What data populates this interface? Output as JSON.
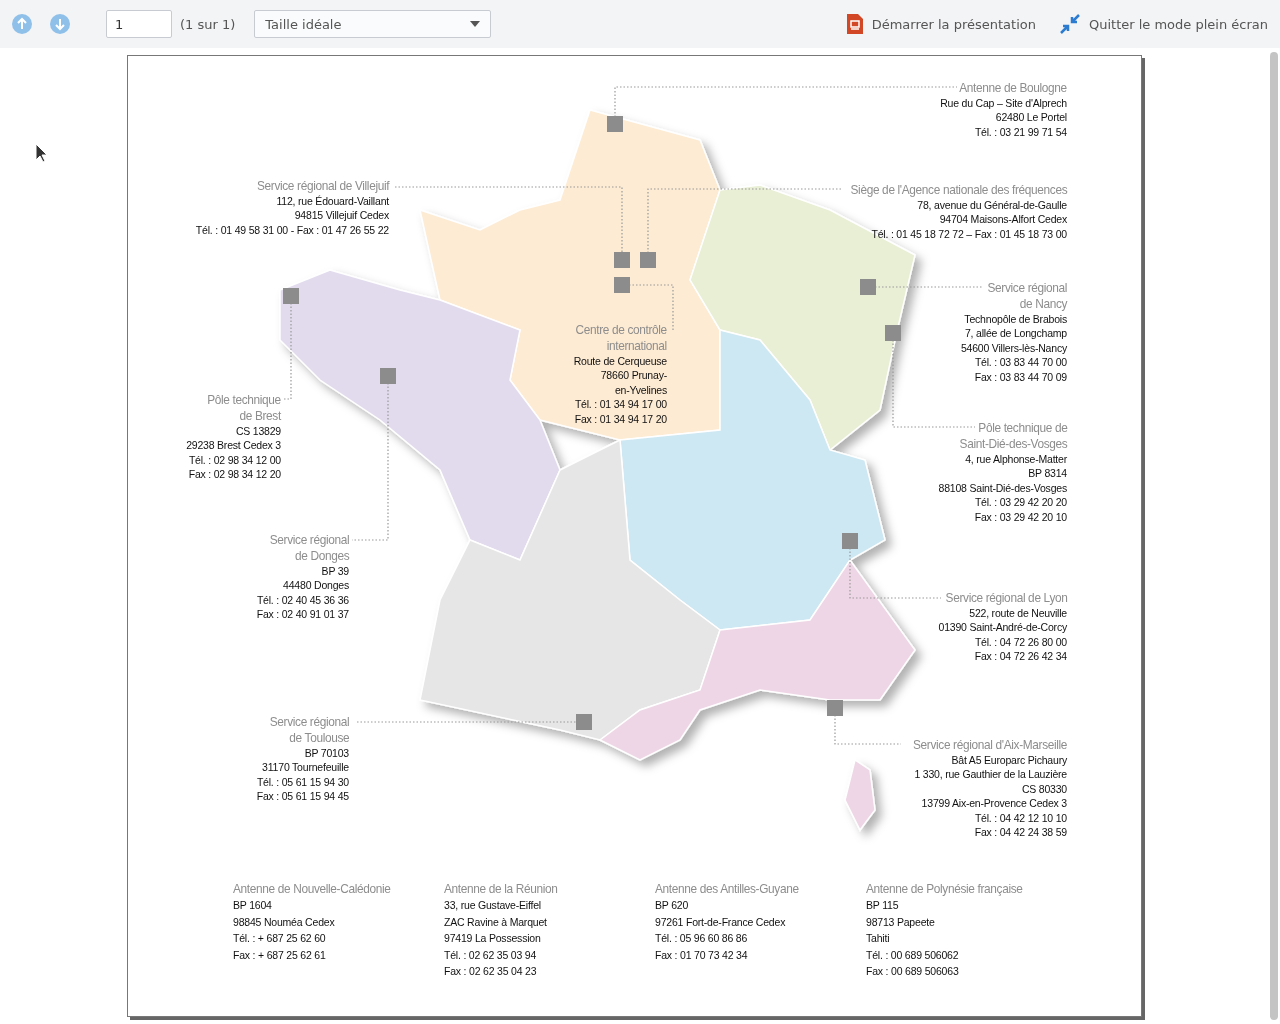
{
  "toolbar": {
    "page_input": "1",
    "page_count": "(1 sur 1)",
    "zoom_select": "Taille idéale",
    "present_button": "Démarrer la présentation",
    "exit_fullscreen_button": "Quitter le mode plein écran"
  },
  "offices": [
    {
      "title": [
        "Antenne de Boulogne"
      ],
      "lines": [
        "Rue du Cap – Site d'Alprech",
        "62480 Le Portel",
        "Tél. : 03 21 99 71 54"
      ]
    },
    {
      "title": [
        "Service régional de Villejuif"
      ],
      "lines": [
        "112, rue Édouard-Vaillant",
        "94815 Villejuif Cedex",
        "Tél. : 01 49 58 31 00 - Fax : 01 47 26 55 22"
      ]
    },
    {
      "title": [
        "Siège de l'Agence nationale des fréquences"
      ],
      "lines": [
        "78, avenue du Général-de-Gaulle",
        "94704 Maisons-Alfort Cedex",
        "Tél. : 01 45 18 72 72 – Fax : 01 45 18 73 00"
      ]
    },
    {
      "title": [
        "Service régional",
        "de Nancy"
      ],
      "lines": [
        "Technopôle de Brabois",
        "7, allée de Longchamp",
        "54600 Villers-lès-Nancy",
        "Tél. : 03 83 44 70 00",
        "Fax : 03 83 44 70 09"
      ]
    },
    {
      "title": [
        "Centre de contrôle",
        "international"
      ],
      "lines": [
        "Route de Cerqueuse",
        "78660 Prunay-",
        "en-Yvelines",
        "Tél. : 01 34 94 17 00",
        "Fax : 01 34 94 17 20"
      ]
    },
    {
      "title": [
        "Pôle technique",
        "de Brest"
      ],
      "lines": [
        "CS 13829",
        "29238 Brest Cedex 3",
        "Tél. : 02 98 34 12 00",
        "Fax : 02 98 34 12 20"
      ]
    },
    {
      "title": [
        "Pôle technique de",
        "Saint-Dié-des-Vosges"
      ],
      "lines": [
        "4, rue Alphonse-Matter",
        "BP 8314",
        "88108 Saint-Dié-des-Vosges",
        "Tél. : 03 29 42 20 20",
        "Fax : 03 29 42 20 10"
      ]
    },
    {
      "title": [
        "Service régional",
        "de Donges"
      ],
      "lines": [
        "BP 39",
        "44480 Donges",
        "Tél. : 02 40 45 36 36",
        "Fax : 02 40 91 01 37"
      ]
    },
    {
      "title": [
        "Service régional de Lyon"
      ],
      "lines": [
        "522, route de Neuville",
        "01390 Saint-André-de-Corcy",
        "Tél. : 04 72 26 80 00",
        "Fax : 04 72 26 42 34"
      ]
    },
    {
      "title": [
        "Service régional",
        "de Toulouse"
      ],
      "lines": [
        "BP 70103",
        "31170 Tournefeuille",
        "Tél. : 05 61 15 94 30",
        "Fax : 05 61 15 94 45"
      ]
    },
    {
      "title": [
        "Service régional d'Aix-Marseille"
      ],
      "lines": [
        "Bât A5 Europarc Pichaury",
        "1 330, rue Gauthier de la Lauzière",
        "CS 80330",
        "13799 Aix-en-Provence Cedex 3",
        "Tél. : 04 42 12 10 10",
        "Fax : 04 42 24 38 59"
      ]
    }
  ],
  "overseas": [
    {
      "title": "Antenne de Nouvelle-Calédonie",
      "lines": [
        "BP 1604",
        "98845 Nouméa Cedex",
        "Tél. : + 687 25 62 60",
        "Fax : + 687 25 62 61"
      ]
    },
    {
      "title": "Antenne de la Réunion",
      "lines": [
        "33, rue Gustave-Eiffel",
        "ZAC Ravine à Marquet",
        "97419 La Possession",
        "Tél. : 02 62 35 03 94",
        "Fax : 02 62 35 04 23"
      ]
    },
    {
      "title": "Antenne des Antilles-Guyane",
      "lines": [
        "BP 620",
        "97261 Fort-de-France Cedex",
        "Tél. : 05 96 60 86 86",
        "Fax : 01 70 73 42 34"
      ]
    },
    {
      "title": "Antenne de Polynésie française",
      "lines": [
        "BP 115",
        "98713 Papeete",
        "Tahiti",
        "Tél. : 00 689 506062",
        "Fax : 00 689 506063"
      ]
    }
  ]
}
